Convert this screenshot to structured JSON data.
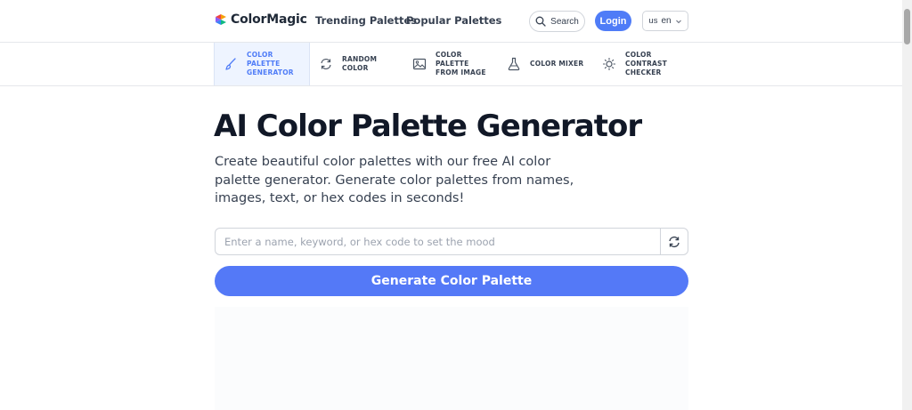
{
  "header": {
    "brand": "ColorMagic",
    "nav": [
      "Trending Palettes",
      "Popular Palettes"
    ],
    "search_label": "Search",
    "login_label": "Login",
    "lang_flag": "us",
    "lang_code": "en"
  },
  "tools": [
    {
      "label": "COLOR\nPALETTE\nGENERATOR",
      "icon": "brush-icon",
      "active": true
    },
    {
      "label": "RANDOM\nCOLOR",
      "icon": "refresh-icon",
      "active": false
    },
    {
      "label": "COLOR\nPALETTE\nFROM IMAGE",
      "icon": "image-icon",
      "active": false
    },
    {
      "label": "COLOR MIXER",
      "icon": "flask-icon",
      "active": false
    },
    {
      "label": "COLOR\nCONTRAST\nCHECKER",
      "icon": "sun-icon",
      "active": false
    }
  ],
  "hero": {
    "title": "AI Color Palette Generator",
    "subtitle": "Create beautiful color palettes with our free AI color palette generator. Generate color palettes from names, images, text, or hex codes in seconds!"
  },
  "form": {
    "placeholder": "Enter a name, keyword, or hex code to set the mood",
    "value": "",
    "generate_label": "Generate Color Palette"
  },
  "colors": {
    "accent": "#4f7cf7",
    "button": "#5479f7",
    "active_tool_bg": "#eef4ff"
  }
}
